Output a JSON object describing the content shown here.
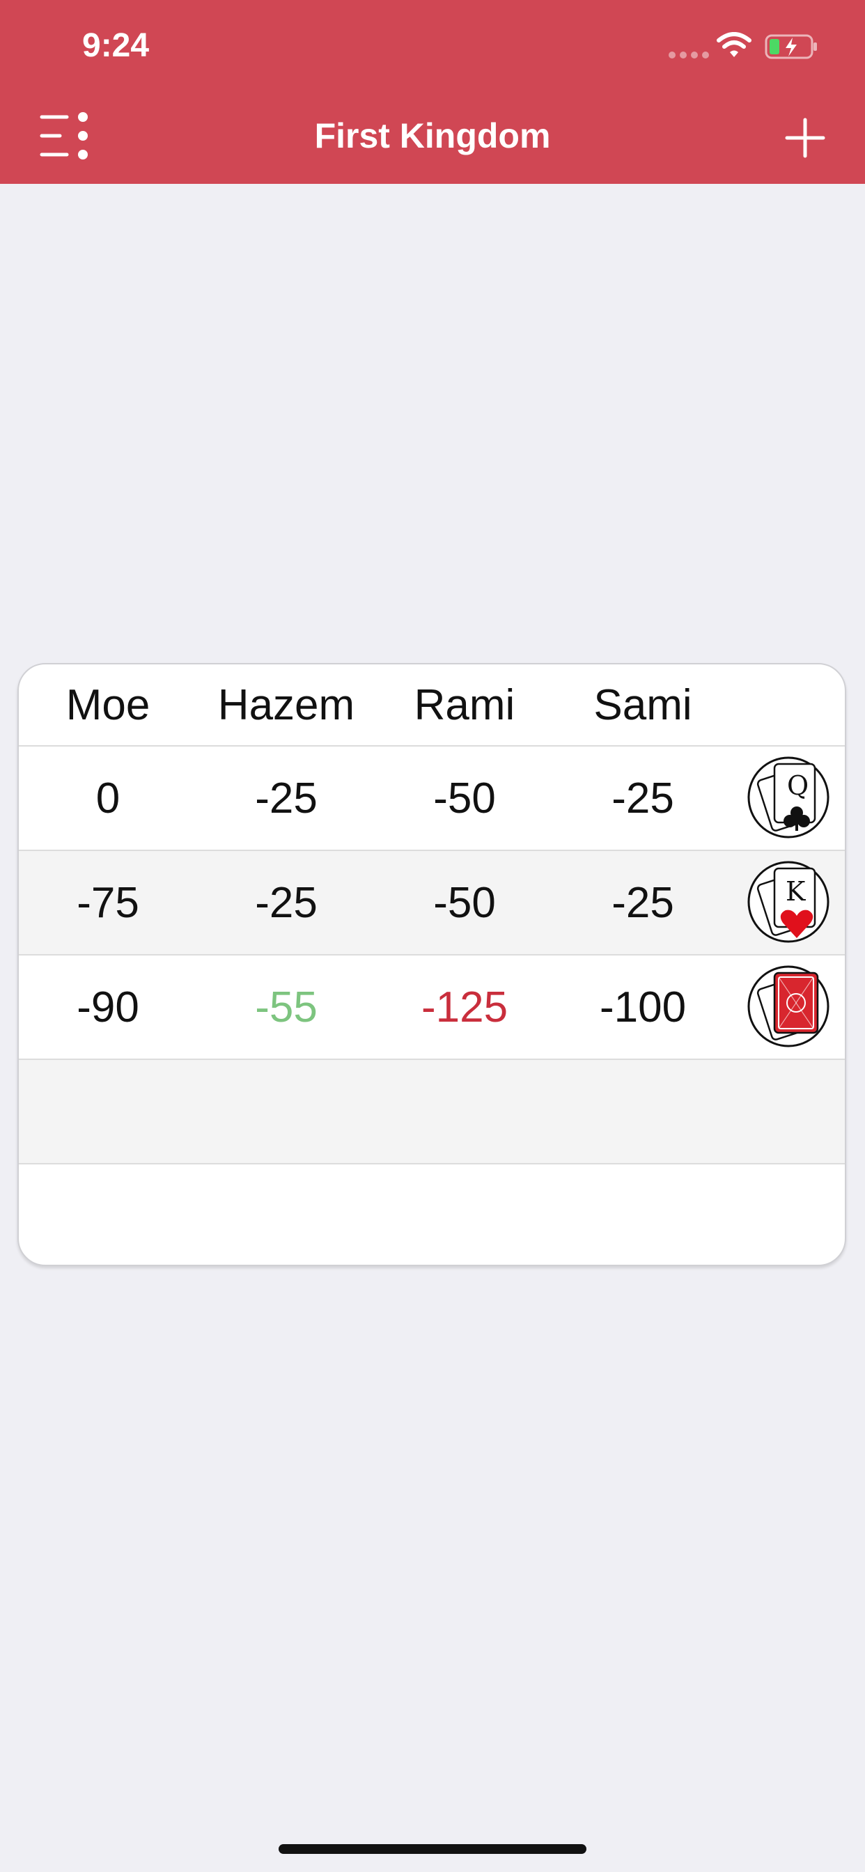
{
  "status_bar": {
    "time": "9:24"
  },
  "nav_bar": {
    "title": "First Kingdom",
    "menu_icon": "list-menu-icon",
    "add_icon": "plus-icon",
    "background_color": "#d04754"
  },
  "score_table": {
    "players": [
      "Moe",
      "Hazem",
      "Rami",
      "Sami"
    ],
    "rows": [
      {
        "scores": [
          "0",
          "-25",
          "-50",
          "-25"
        ],
        "badge_icon": "queen-of-clubs-icon"
      },
      {
        "scores": [
          "-75",
          "-25",
          "-50",
          "-25"
        ],
        "badge_icon": "king-of-hearts-icon"
      },
      {
        "scores": [
          "-90",
          "-55",
          "-125",
          "-100"
        ],
        "badge_icon": "card-back-icon"
      },
      {
        "scores": [
          "",
          "",
          "",
          ""
        ],
        "badge_icon": ""
      },
      {
        "scores": [
          "",
          "",
          "",
          ""
        ],
        "badge_icon": ""
      }
    ],
    "colors": {
      "best_score": "#7dc47f",
      "worst_score": "#c92e3c"
    }
  }
}
